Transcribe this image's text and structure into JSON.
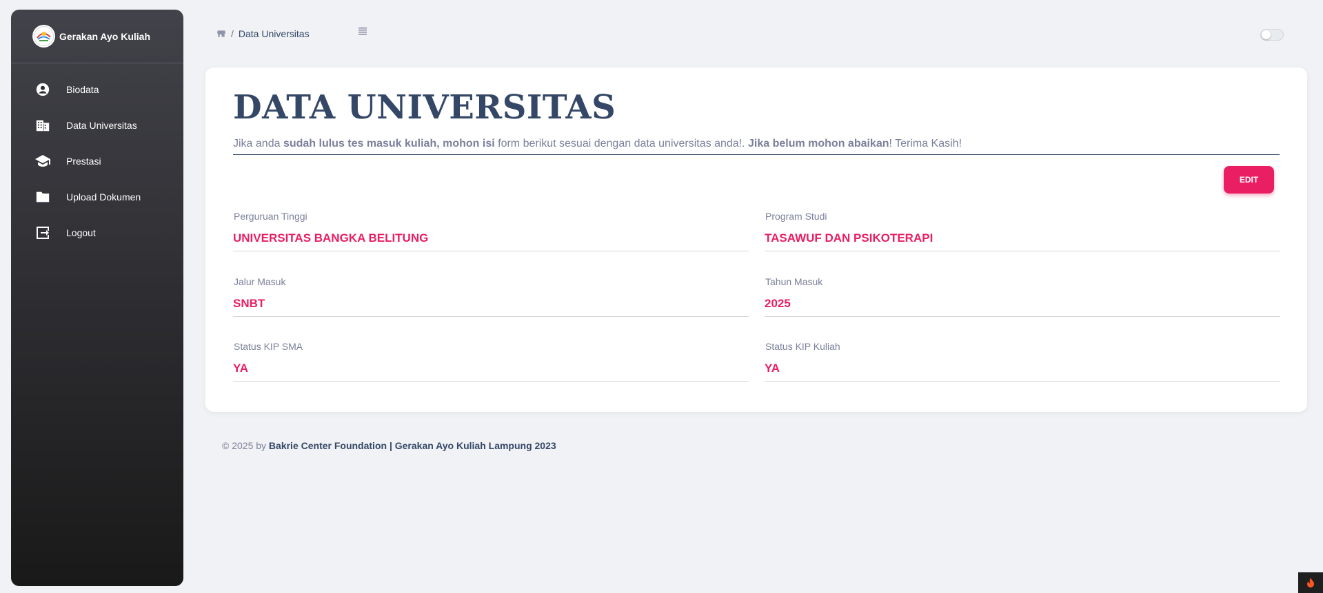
{
  "sidebar": {
    "brand": "Gerakan Ayo Kuliah",
    "items": [
      {
        "label": "Biodata",
        "icon": "user-circle-icon"
      },
      {
        "label": "Data Universitas",
        "icon": "building-icon"
      },
      {
        "label": "Prestasi",
        "icon": "graduation-cap-icon"
      },
      {
        "label": "Upload Dokumen",
        "icon": "folder-icon"
      },
      {
        "label": "Logout",
        "icon": "logout-icon"
      }
    ]
  },
  "breadcrumb": {
    "separator": "/",
    "current": "Data Universitas"
  },
  "card": {
    "title": "DATA UNIVERSITAS",
    "intro": {
      "p1": "Jika anda ",
      "b1": "sudah lulus tes masuk kuliah, mohon isi",
      "p2": " form berikut sesuai dengan data universitas anda!. ",
      "b2": "Jika belum mohon abaikan",
      "p3": "! Terima Kasih!"
    },
    "edit_label": "EDIT",
    "fields": [
      {
        "label": "Perguruan Tinggi",
        "value": "UNIVERSITAS BANGKA BELITUNG"
      },
      {
        "label": "Program Studi",
        "value": "TASAWUF DAN PSIKOTERAPI"
      },
      {
        "label": "Jalur Masuk",
        "value": "SNBT"
      },
      {
        "label": "Tahun Masuk",
        "value": "2025"
      },
      {
        "label": "Status KIP SMA",
        "value": "YA"
      },
      {
        "label": "Status KIP Kuliah",
        "value": "YA"
      }
    ]
  },
  "footer": {
    "prefix": "© 2025 by ",
    "strong": "Bakrie Center Foundation | Gerakan Ayo Kuliah Lampung 2023"
  },
  "colors": {
    "accent": "#e91e63",
    "heading": "#344767",
    "muted": "#7b809a"
  }
}
